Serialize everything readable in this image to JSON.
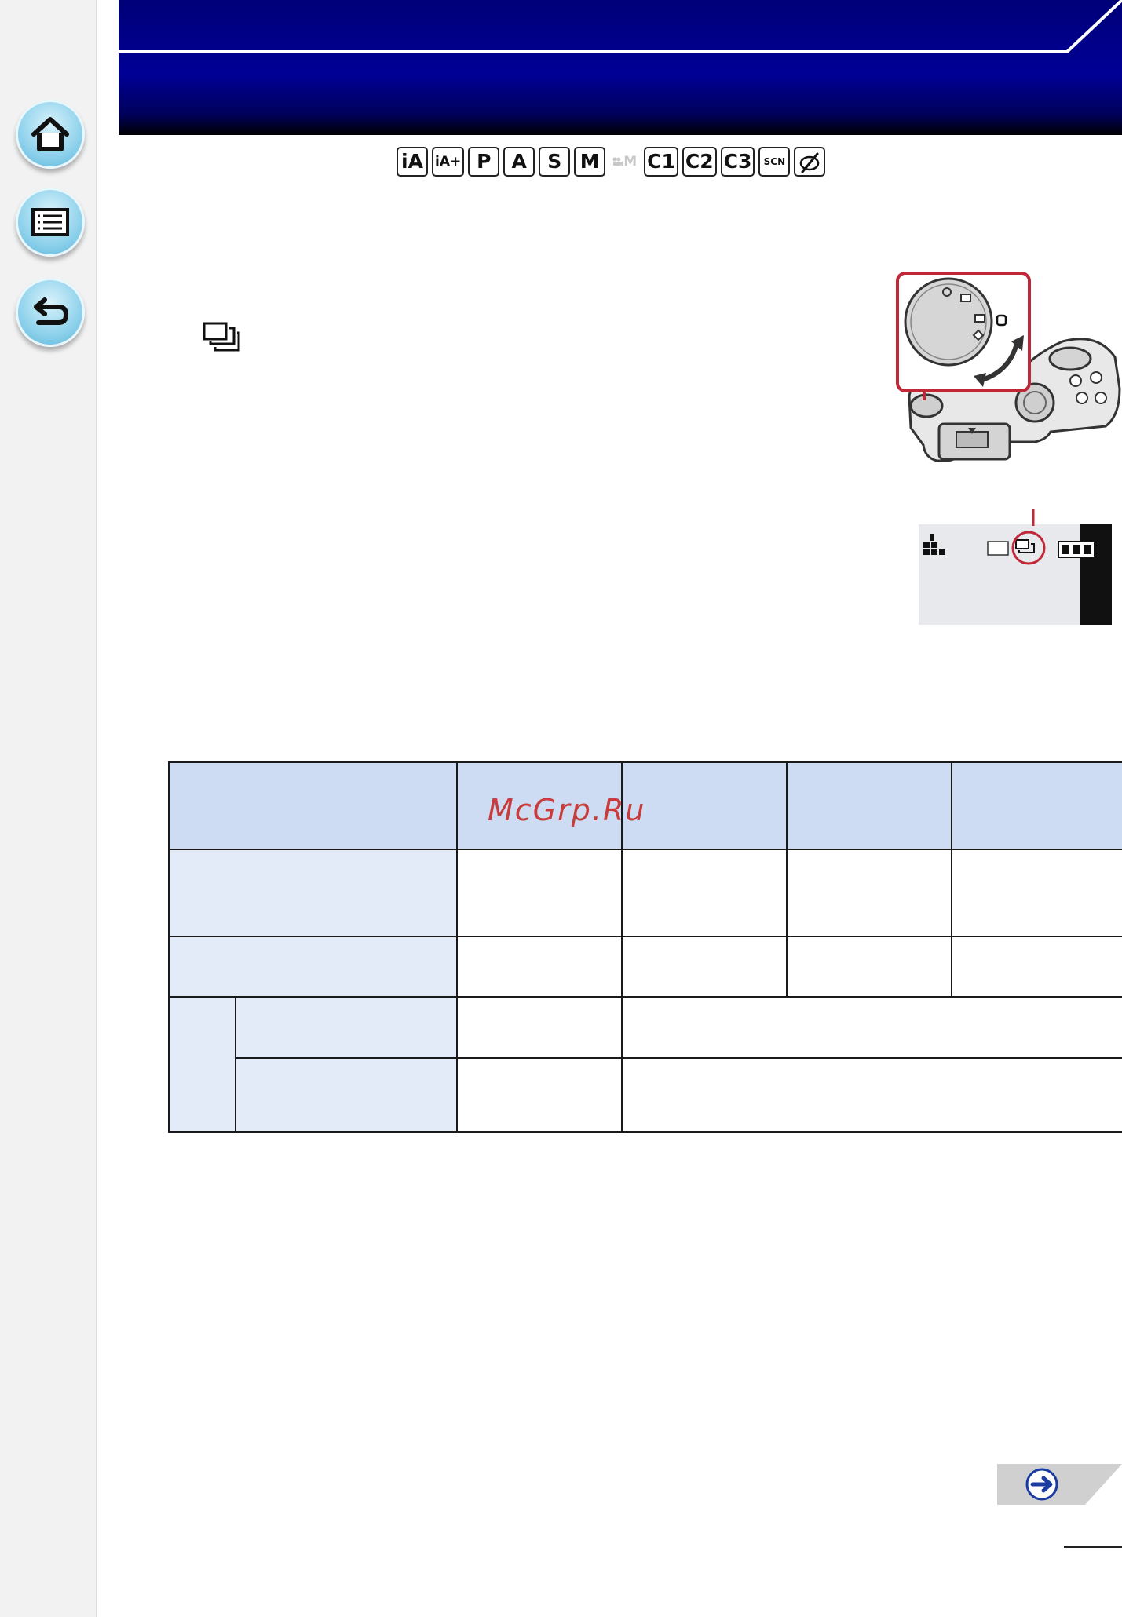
{
  "sidebar": {
    "home_icon": "home-icon",
    "contents_icon": "list-icon",
    "back_icon": "return-arrow-icon"
  },
  "header": {
    "background_color": "#000090"
  },
  "modes": {
    "items": [
      "iA",
      "iA+",
      "P",
      "A",
      "S",
      "M",
      "C1",
      "C2",
      "C3",
      "SCN",
      "creative"
    ],
    "disabled": "M"
  },
  "watermark": "McGrp.Ru",
  "colors": {
    "table_header": "#cddbf3",
    "table_label": "#e3eaf8",
    "highlight": "#c0283a"
  }
}
